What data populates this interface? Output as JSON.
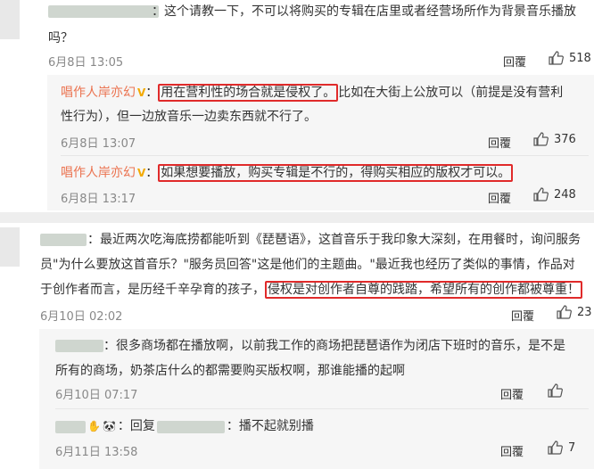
{
  "c1": {
    "text1": "：这个请教一下，不可以将购买的专辑在店里或者经营场所作为背景音乐播放",
    "text2": "吗？",
    "time": "6月8日 13:05",
    "reply": "回覆",
    "likes": "518"
  },
  "r1": {
    "name": "唱作人岸亦幻",
    "badge": "V",
    "colon": "：",
    "highlight": "用在营利性的场合就是侵权了。",
    "rest1": "比如在大街上公放可以（前提是没有营利",
    "line2": "性行为），但一边放音乐一边卖东西就不行了。",
    "time": "6月8日 13:07",
    "reply": "回覆",
    "likes": "376"
  },
  "r2": {
    "name": "唱作人岸亦幻",
    "badge": "V",
    "colon": "：",
    "highlight": "如果想要播放，购买专辑是不行的，得购买相应的版权才可以。",
    "time": "6月8日 13:17",
    "reply": "回覆",
    "likes": "248"
  },
  "c2": {
    "line1": "：最近两次吃海底捞都能听到《琵琶语》，这首音乐于我印象大深刻，在用餐时，询问服务",
    "line2": "员\"为什么要放这首音乐？\"服务员回答\"这是他们的主题曲。\"最近我也经历了类似的事情，作品对",
    "line3": "于创作者而言，是历经千辛孕育的孩子，",
    "highlight": "侵权是对创作者自尊的践踏，希望所有的创作都被尊重！",
    "time": "6月10日 02:02",
    "reply": "回覆",
    "likes": "23"
  },
  "r3": {
    "line1": "：很多商场都在播放啊，以前我工作的商场把琵琶语作为闭店下班时的音乐，是不是",
    "line2": "所有的商场，奶茶店什么的都需要购买版权啊，那谁能播的起啊",
    "time": "6月10日 07:17",
    "reply": "回覆",
    "likes": ""
  },
  "r4": {
    "prefix": "：回复",
    "suffix": "：播不起就别播",
    "time": "6月11日 13:58",
    "reply": "回覆",
    "likes": "7"
  }
}
